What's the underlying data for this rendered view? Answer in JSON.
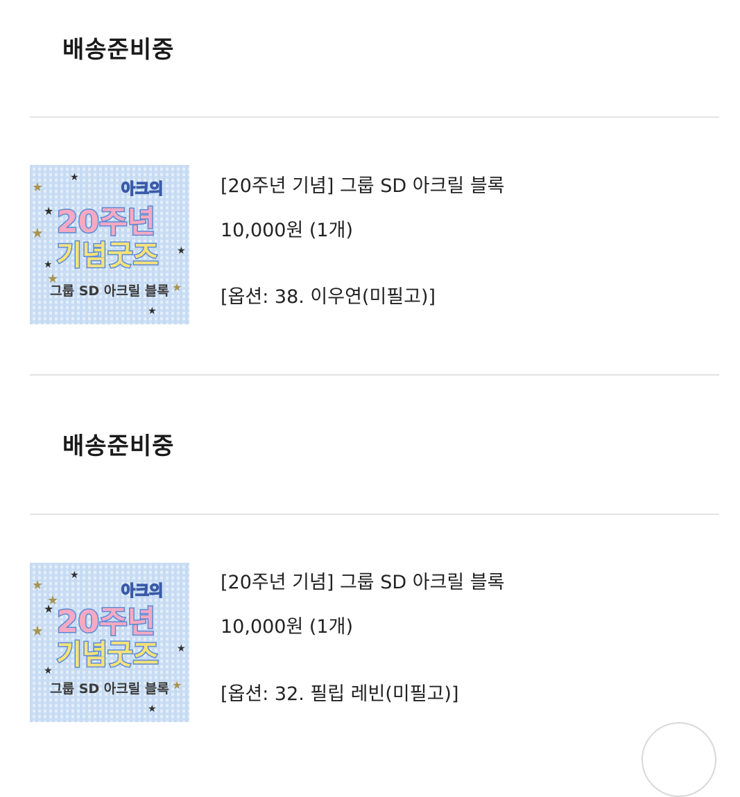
{
  "orders": [
    {
      "status": "배송준비중",
      "product_name": "[20주년 기념] 그룹 SD 아크릴 블록",
      "price": "10,000원 (1개)",
      "option": "[옵션: 38. 이우연(미필고)]",
      "thumb": {
        "line1": "아크의",
        "line2": "20주년",
        "line3": "기념굿즈",
        "line4": "그룹 SD 아크릴 블록"
      }
    },
    {
      "status": "배송준비중",
      "product_name": "[20주년 기념] 그룹 SD 아크릴 블록",
      "price": "10,000원 (1개)",
      "option": "[옵션: 32. 필립 레빈(미필고)]",
      "thumb": {
        "line1": "아크의",
        "line2": "20주년",
        "line3": "기념굿즈",
        "line4": "그룹 SD 아크릴 블록"
      }
    }
  ],
  "colors": {
    "thumb_bg": "#cfe2f7",
    "pink_text": "#f5a9c3",
    "yellow_text": "#f6e27a",
    "outline_blue": "#5a8ad6"
  }
}
